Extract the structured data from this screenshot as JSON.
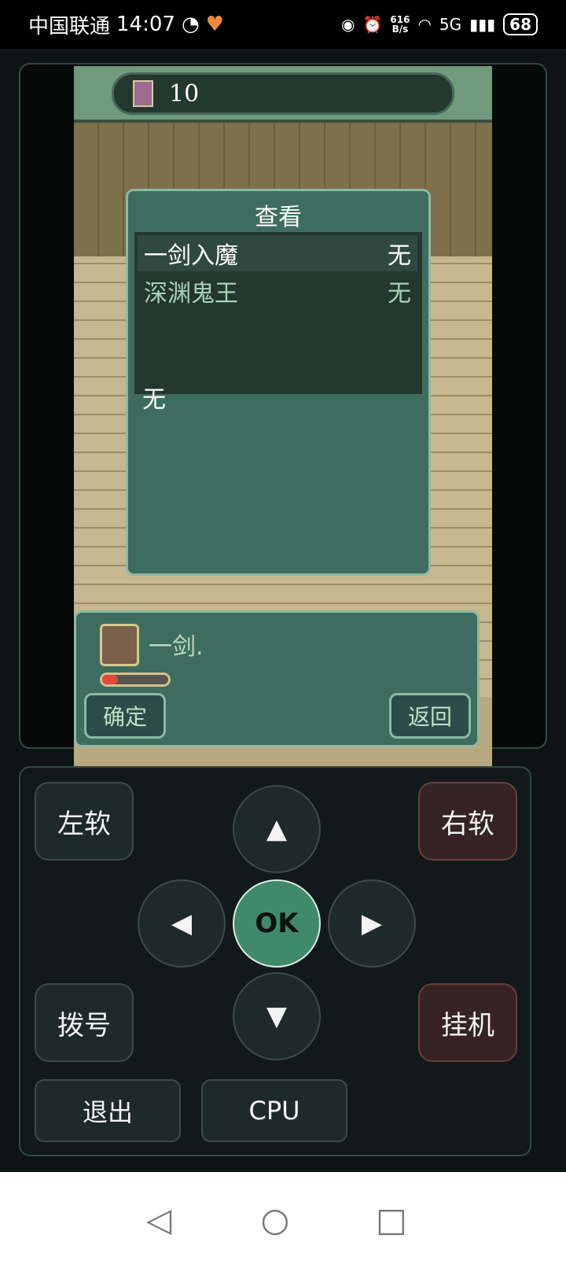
{
  "status_bar": {
    "carrier": "中国联通",
    "time": "14:07",
    "speed_top": "616",
    "speed_unit": "B/s",
    "network": "5G",
    "battery": "68"
  },
  "game": {
    "turn_count": "10",
    "dialog": {
      "title": "查看",
      "items": [
        {
          "name": "一剑入魔",
          "value": "无"
        },
        {
          "name": "深渊鬼王",
          "value": "无"
        }
      ],
      "empty_text": "无"
    },
    "message": "一剑.",
    "hp_fraction": 0.24,
    "confirm_label": "确定",
    "back_label": "返回"
  },
  "controls": {
    "left_soft": "左软",
    "right_soft": "右软",
    "up": "▲",
    "ok": "OK",
    "left": "◀",
    "right": "▶",
    "down": "▼",
    "dial": "拨号",
    "hangup": "挂机",
    "exit": "退出",
    "cpu": "CPU"
  },
  "nav": {
    "back": "◁",
    "home": "○",
    "recents": "□"
  }
}
